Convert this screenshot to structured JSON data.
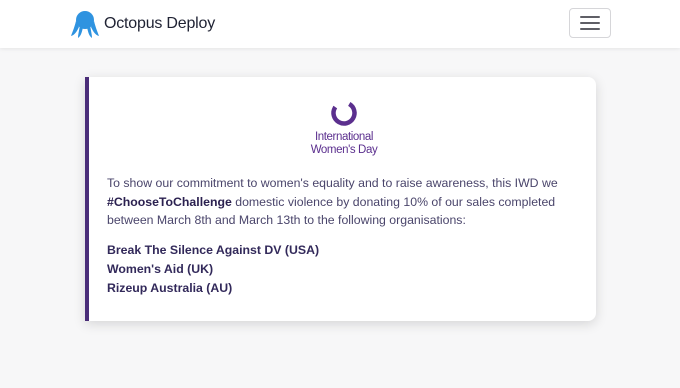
{
  "navbar": {
    "brand_name": "Octopus Deploy",
    "brand_icon": "octopus-logo-icon",
    "menu_icon": "hamburger-menu-icon"
  },
  "announcement": {
    "logo_text": [
      "International",
      "Women's Day"
    ],
    "logo_icon": "iwd-ring-icon",
    "text_before": "To show our commitment to women's equality and to raise awareness, this IWD we ",
    "hashtag": "#ChooseToChallenge",
    "text_after": " domestic violence by donating 10% of our sales completed between March 8th and March 13th to the following organisations:",
    "organisations": [
      "Break The Silence Against DV (USA)",
      "Women's Aid (UK)",
      "Rizeup Australia (AU)"
    ]
  },
  "colors": {
    "accent": "#4a2d78",
    "brand_blue": "#2f93e0",
    "iwd_purple": "#5b2f8e",
    "background": "#f7f7f8"
  }
}
